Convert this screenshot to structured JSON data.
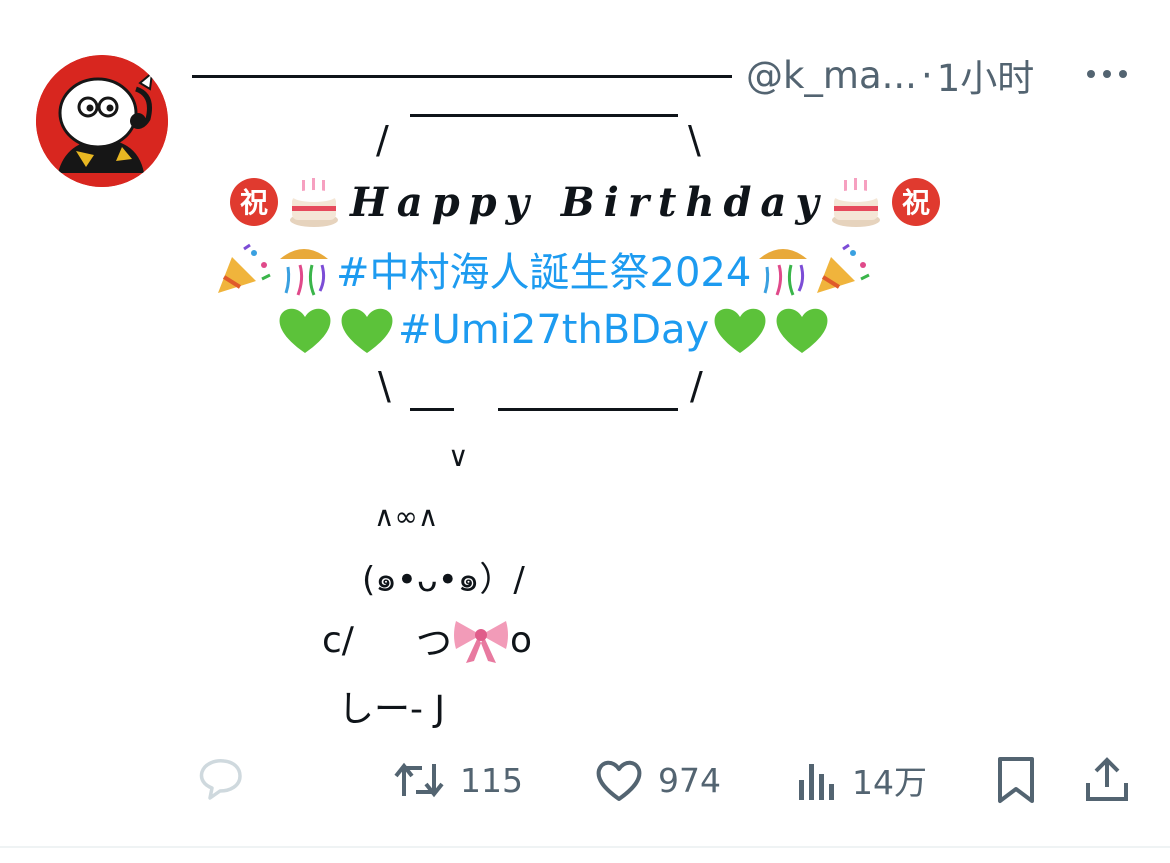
{
  "tweet": {
    "display_name": "—————————————",
    "handle": "@k_ma...",
    "separator": "·",
    "time": "1小时",
    "colors": {
      "text": "#0f1419",
      "secondary": "#536471",
      "link": "#1d9bf0",
      "avatar_bg": "#d8261f"
    },
    "icons": {
      "more": "more-dots-icon",
      "avatar": "mascot-avatar",
      "celebrate": "congratulation-ideograph-icon",
      "cake": "birthday-cake-icon",
      "popper": "party-popper-icon",
      "confetti": "confetti-ball-icon",
      "heart": "green-heart-icon",
      "ribbon": "pink-ribbon-icon"
    },
    "body": {
      "top_left": "/",
      "top_right": "\\",
      "birthday_text": "Happy Birthday",
      "hashtag1": "#中村海人誕生祭2024",
      "hashtag2": "#Umi27thBDay",
      "bottom_left": "\\",
      "bottom_right": "/",
      "pointer": "∨",
      "ears": "∧∞∧",
      "face": "(๑•ᴗ•๑）/",
      "arms_left": "c/",
      "arms_mid": "つ",
      "arms_right": "o",
      "feet": "しー- J"
    }
  },
  "actions": {
    "reply": {
      "icon": "reply-icon",
      "count": ""
    },
    "retweet": {
      "icon": "retweet-icon",
      "count": "115"
    },
    "like": {
      "icon": "heart-icon",
      "count": "974"
    },
    "views": {
      "icon": "views-bars-icon",
      "count": "14万"
    },
    "bookmark": {
      "icon": "bookmark-icon"
    },
    "share": {
      "icon": "share-icon"
    }
  }
}
